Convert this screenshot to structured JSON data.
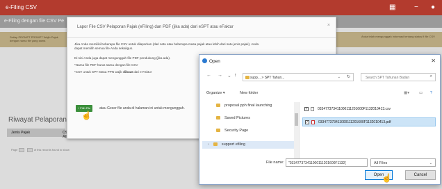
{
  "app": {
    "title": "e-Filing CSV"
  },
  "page": {
    "title": "e-Filing dengan file CSV Pe"
  },
  "notice": {
    "left_text": "Setiap PROMPT PROMPT Wajib Pajak dengan nama file yang sama",
    "right_text": "Anda telah mengunggah informasi tentang status fi file CSV"
  },
  "history": {
    "title": "Riwayat Pelaporan",
    "columns": [
      "Jenis Pajak",
      "CSV & File Attachment"
    ],
    "pager_text": "of this records found to show",
    "page_label": "Page"
  },
  "efiling_dialog": {
    "title": "Lapor File CSV Pelaporan Pajak (eFiling) dan PDF (jika ada) dari eSPT atau eFaktur",
    "close": "×",
    "para1": "Jika Anda memiliki beberapa file CSV untuk dilaporkan (dari satu atau beberapa masa pajak atau lebih dari satu jenis pajak), Anda dapat memilih semua file Anda sekaligus.",
    "para2": "Di sini Anda juga dapat mengunggah file PDF pendukung (jika ada).",
    "para3": "*Nama file PDF harus sama dengan file CSV",
    "para4_prefix": "*CSV untuk SPT Masa PPN wajib ",
    "para4_bold": "dibuat",
    "para4_suffix": " dari e-Faktur",
    "upload_button": "+ Pilih File",
    "upload_hint": "atau Geser file anda di halaman ini untuk mengunggah."
  },
  "open_dialog": {
    "title": "Open",
    "close": "✕",
    "address": [
      "supp...",
      "SPT Tahun..."
    ],
    "search_placeholder": "Search SPT Tahunan Badan",
    "toolbar": {
      "organize": "Organize ▾",
      "new_folder": "New folder"
    },
    "tree_items": [
      "proposal pph final launching",
      "Saved Pictures",
      "Security Page",
      "support efiling"
    ],
    "files": [
      {
        "name": "033477373411000111120160 0F1132010413.csv",
        "display": "033477373411000111201600F1132010413.csv",
        "checked": true,
        "type": "csv"
      },
      {
        "name": "033477373411000111201600F1132010413.pdf",
        "display": "033477373411000111201600F1132010413.pdf",
        "checked": true,
        "type": "pdf"
      }
    ],
    "file_name_label": "File name:",
    "file_name_value": "\"033477373411000111201600F1132(",
    "file_type": "All Files",
    "open_button": "Open",
    "cancel_button": "Cancel"
  }
}
